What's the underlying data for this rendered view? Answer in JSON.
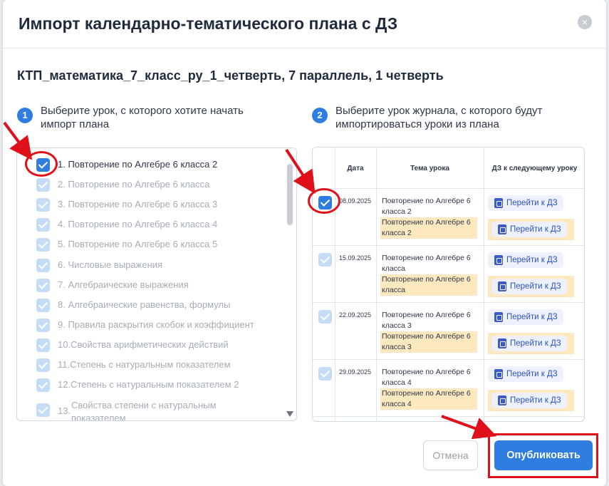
{
  "modal": {
    "title": "Импорт календарно-тематического плана с ДЗ",
    "close_symbol": "×",
    "subtitle": "КТП_математика_7_класс_ру_1_четверть, 7 параллель, 1 четверть"
  },
  "step1": {
    "number": "1",
    "text_line1": "Выберите урок, с которого хотите начать",
    "text_line2": "импорт плана"
  },
  "step2": {
    "number": "2",
    "text_line1": "Выберите урок журнала, с которого будут",
    "text_line2": "импортироваться уроки из плана"
  },
  "lessons": [
    {
      "label": "1.  Повторение по Алгебре 6 класса 2"
    },
    {
      "label": "2.  Повторение по Алгебре 6 класса"
    },
    {
      "label": "3.  Повторение по Алгебре 6 класса 3"
    },
    {
      "label": "4.  Повторение по Алгебре 6 класса 4"
    },
    {
      "label": "5.  Повторение по Алгебре 6 класса 5"
    },
    {
      "label": "6.  Числовые выражения"
    },
    {
      "label": "7.  Алгебраические выражения"
    },
    {
      "label": "8.  Алгебраические равенства, формулы"
    },
    {
      "label": "9.  Правила раскрытия скобок и коэффициент"
    },
    {
      "label": "10.Свойства арифметических действий"
    },
    {
      "label": "11.Степень с натуральным показателем"
    },
    {
      "label": "12.Степень с натуральным показателем 2"
    },
    {
      "label": "13.",
      "label_text": "Свойства степени с натуральным показателем"
    }
  ],
  "journal": {
    "headers": {
      "date": "Дата",
      "topic": "Тема урока",
      "homework": "ДЗ к следующему уроку"
    },
    "rows": [
      {
        "date": "08.09.2025",
        "topic": "Повторение по Алгебре 6 класса 2",
        "topic_plan": "Повторение по Алгебре 6 класса 2",
        "hw1": "Перейти к ДЗ",
        "hw2": "Перейти к ДЗ"
      },
      {
        "date": "15.09.2025",
        "topic": "Повторение по Алгебре 6 класса",
        "topic_plan": "Повторение по Алгебре 6 класса",
        "hw1": "Перейти к ДЗ",
        "hw2": "Перейти к ДЗ"
      },
      {
        "date": "22.09.2025",
        "topic": "Повторение по Алгебре 6 класса 3",
        "topic_plan": "Повторение по Алгебре 6 класса 3",
        "hw1": "Перейти к ДЗ",
        "hw2": "Перейти к ДЗ"
      },
      {
        "date": "29.09.2025",
        "topic": "Повторение по Алгебре 6 класса 4",
        "topic_plan": "Повторение по Алгебре 6 класса 4",
        "hw1": "Перейти к ДЗ",
        "hw2": "Перейти к ДЗ"
      }
    ]
  },
  "footer": {
    "cancel_label": "Отмена",
    "publish_label": "Опубликовать"
  },
  "colors": {
    "primary": "#2f7de1",
    "highlight": "#fde8bf",
    "annotation": "#e0101a"
  }
}
